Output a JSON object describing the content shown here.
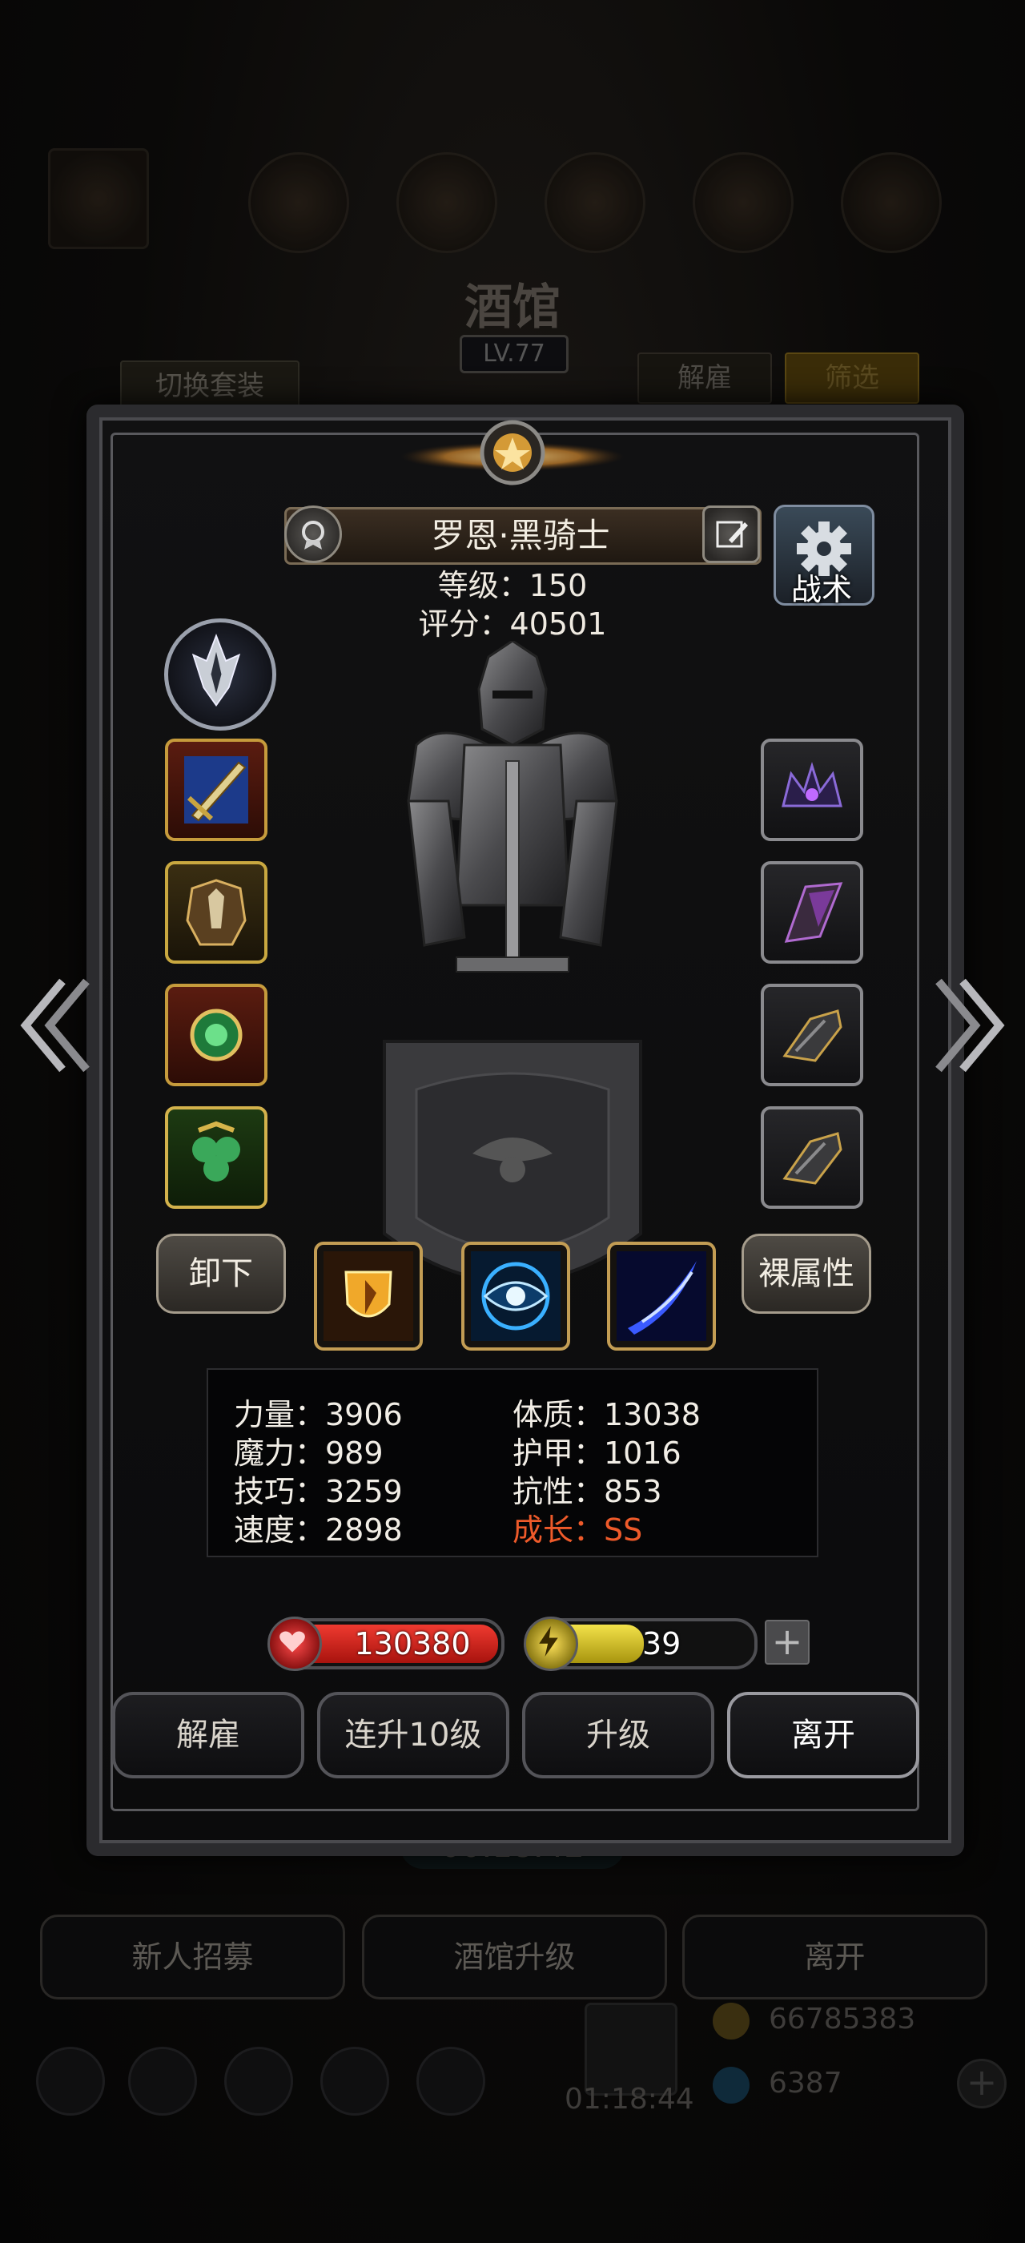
{
  "background": {
    "title": "酒馆",
    "level": "LV.77",
    "switch_outfit": "切换套装",
    "dismiss_tab": "解雇",
    "filter_tab": "筛选",
    "timer": "00:18:42",
    "buttons": [
      "新人招募",
      "酒馆升级",
      "离开"
    ],
    "bottom_timer": "01:18:44",
    "currency_gold": "66785383",
    "currency_gem": "6387"
  },
  "hero": {
    "name": "罗恩·黑骑士",
    "level_text": "等级：150",
    "score_text": "评分：40501",
    "tactics_label": "战术"
  },
  "equipment_left": [
    "sword-icon",
    "armor-icon",
    "emerald-amulet-icon",
    "clover-ring-icon"
  ],
  "equipment_right": [
    "void-crown-icon",
    "crystal-blade-icon",
    "gauntlet-icon",
    "gauntlet-icon"
  ],
  "skills": [
    "golden-shield-icon",
    "blue-eye-icon",
    "blue-slash-icon"
  ],
  "side_buttons": {
    "unequip": "卸下",
    "base_attr": "裸属性"
  },
  "stats": {
    "strength": "力量：3906",
    "magic": "魔力：989",
    "skill": "技巧：3259",
    "speed": "速度：2898",
    "constitution": "体质：13038",
    "armor": "护甲：1016",
    "resistance": "抗性：853",
    "growth_label": "成长：",
    "growth_value": "SS"
  },
  "bars": {
    "hp": "130380",
    "energy": "39",
    "energy_fill": 0.52,
    "plus": "+"
  },
  "actions": [
    "解雇",
    "连升10级",
    "升级",
    "离开"
  ],
  "colors": {
    "hp": "#c8231e",
    "energy": "#d4c020",
    "growth": "#ee5a2a"
  }
}
